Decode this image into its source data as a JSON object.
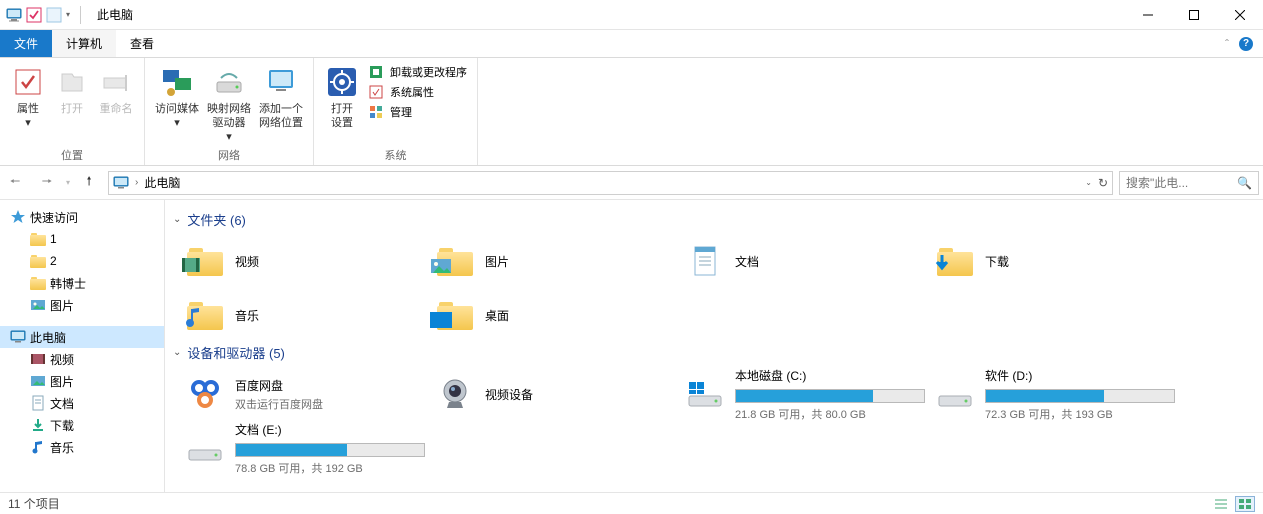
{
  "window": {
    "title": "此电脑"
  },
  "tabs": {
    "file": "文件",
    "computer": "计算机",
    "view": "查看"
  },
  "ribbon": {
    "location": {
      "properties": "属性",
      "open": "打开",
      "rename": "重命名",
      "group": "位置"
    },
    "network": {
      "access": "访问媒体",
      "map": "映射网络",
      "map2": "驱动器",
      "addloc": "添加一个",
      "addloc2": "网络位置",
      "group": "网络"
    },
    "system": {
      "open": "打开",
      "open2": "设置",
      "uninstall": "卸载或更改程序",
      "props": "系统属性",
      "manage": "管理",
      "group": "系统"
    }
  },
  "breadcrumb": {
    "root": "此电脑"
  },
  "search": {
    "placeholder": "搜索\"此电..."
  },
  "tree": {
    "quick": "快速访问",
    "q1": "1",
    "q2": "2",
    "q3": "韩博士",
    "q4": "图片",
    "thispc": "此电脑",
    "videos": "视频",
    "pictures": "图片",
    "documents": "文档",
    "downloads": "下载",
    "music": "音乐"
  },
  "groups": {
    "folders": "文件夹 (6)",
    "devices": "设备和驱动器 (5)"
  },
  "folders": {
    "videos": "视频",
    "pictures": "图片",
    "documents": "文档",
    "downloads": "下载",
    "music": "音乐",
    "desktop": "桌面"
  },
  "devices": {
    "baidu": {
      "name": "百度网盘",
      "sub": "双击运行百度网盘"
    },
    "camera": {
      "name": "视频设备"
    },
    "c": {
      "name": "本地磁盘 (C:)",
      "sub": "21.8 GB 可用，共 80.0 GB",
      "pct": 73
    },
    "d": {
      "name": "软件 (D:)",
      "sub": "72.3 GB 可用，共 193 GB",
      "pct": 63
    },
    "e": {
      "name": "文档 (E:)",
      "sub": "78.8 GB 可用，共 192 GB",
      "pct": 59
    }
  },
  "status": {
    "count": "11 个项目"
  }
}
